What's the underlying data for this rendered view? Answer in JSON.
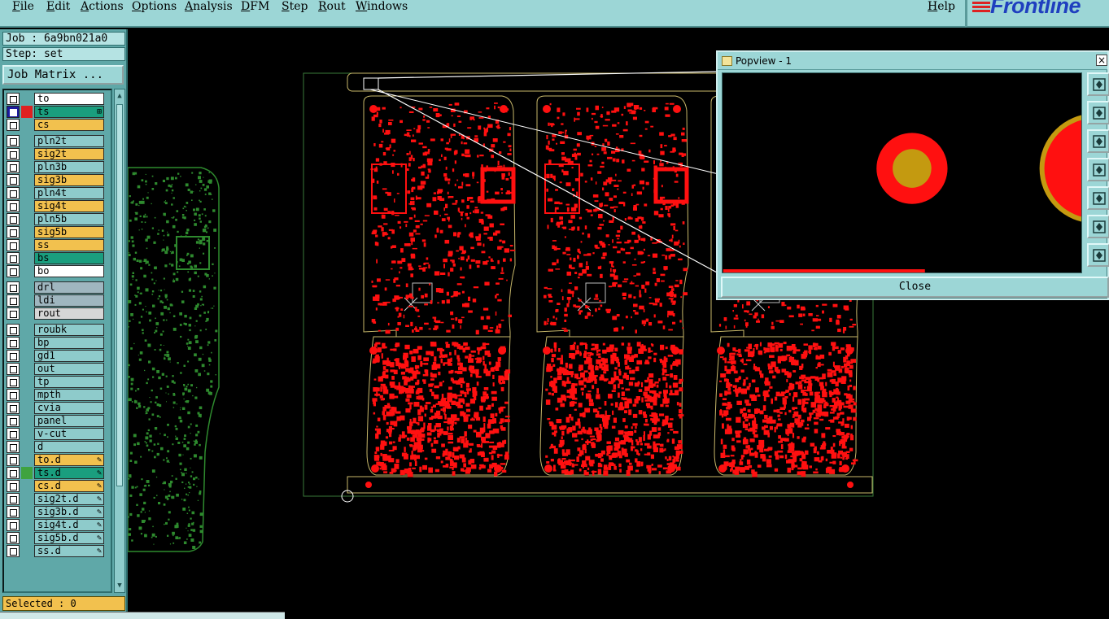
{
  "menubar": {
    "items": [
      "File",
      "Edit",
      "Actions",
      "Options",
      "Analysis",
      "DFM",
      "Step",
      "Rout",
      "Windows"
    ],
    "help": "Help"
  },
  "logo": {
    "text": "Frontline"
  },
  "leftpanel": {
    "job": "Job : 6a9bn021a0",
    "step": "Step: set",
    "job_matrix": "Job Matrix ...",
    "selected": "Selected : 0"
  },
  "layers": [
    {
      "name": "to",
      "color": "#ffffff"
    },
    {
      "name": "ts",
      "color": "#1a9e7e",
      "affected": true,
      "indicator": "#e02020",
      "mark": "⊞"
    },
    {
      "name": "cs",
      "color": "#f2c14e"
    },
    {
      "name": "pln2t",
      "color": "#8ecbcb"
    },
    {
      "name": "sig2t",
      "color": "#f2c14e"
    },
    {
      "name": "pln3b",
      "color": "#8ecbcb"
    },
    {
      "name": "sig3b",
      "color": "#f2c14e"
    },
    {
      "name": "pln4t",
      "color": "#8ecbcb"
    },
    {
      "name": "sig4t",
      "color": "#f2c14e"
    },
    {
      "name": "pln5b",
      "color": "#8ecbcb"
    },
    {
      "name": "sig5b",
      "color": "#f2c14e"
    },
    {
      "name": "ss",
      "color": "#f2c14e"
    },
    {
      "name": "bs",
      "color": "#1a9e7e"
    },
    {
      "name": "bo",
      "color": "#ffffff"
    },
    {
      "name": "drl",
      "color": "#9fb6bf"
    },
    {
      "name": "ldi",
      "color": "#9fb6bf"
    },
    {
      "name": "rout",
      "color": "#d6d6d6"
    },
    {
      "name": "roubk",
      "color": "#8ecbcb"
    },
    {
      "name": "bp",
      "color": "#8ecbcb"
    },
    {
      "name": "gd1",
      "color": "#8ecbcb"
    },
    {
      "name": "out",
      "color": "#8ecbcb"
    },
    {
      "name": "tp",
      "color": "#8ecbcb"
    },
    {
      "name": "mpth",
      "color": "#8ecbcb"
    },
    {
      "name": "cvia",
      "color": "#8ecbcb"
    },
    {
      "name": "panel",
      "color": "#8ecbcb"
    },
    {
      "name": "v-cut",
      "color": "#8ecbcb"
    },
    {
      "name": "d",
      "color": "#8ecbcb"
    },
    {
      "name": "to.d",
      "color": "#f2c14e",
      "mark": "✎"
    },
    {
      "name": "ts.d",
      "color": "#1a9e7e",
      "indicator": "#3fa33f",
      "mark": "✎"
    },
    {
      "name": "cs.d",
      "color": "#f2c14e",
      "mark": "✎"
    },
    {
      "name": "sig2t.d",
      "color": "#8ecbcb",
      "mark": "✎"
    },
    {
      "name": "sig3b.d",
      "color": "#8ecbcb",
      "mark": "✎"
    },
    {
      "name": "sig4t.d",
      "color": "#8ecbcb",
      "mark": "✎"
    },
    {
      "name": "sig5b.d",
      "color": "#8ecbcb",
      "mark": "✎"
    },
    {
      "name": "ss.d",
      "color": "#8ecbcb",
      "mark": "✎"
    }
  ],
  "popview": {
    "title": "Popview - 1",
    "close_x": "×",
    "close": "Close",
    "tools": [
      "zoom-fit-icon",
      "pan-up-icon",
      "pan-down-icon",
      "pan-left-icon",
      "pan-right-icon",
      "zoom-in-icon",
      "zoom-out-icon"
    ]
  },
  "colors": {
    "panel_bg": "#5fa8a8",
    "chrome": "#9cd6d6",
    "board_red": "#ff1010",
    "board_outline": "#c8b86a",
    "side_green": "#2e8a2e",
    "pad_gold": "#c49a10"
  }
}
